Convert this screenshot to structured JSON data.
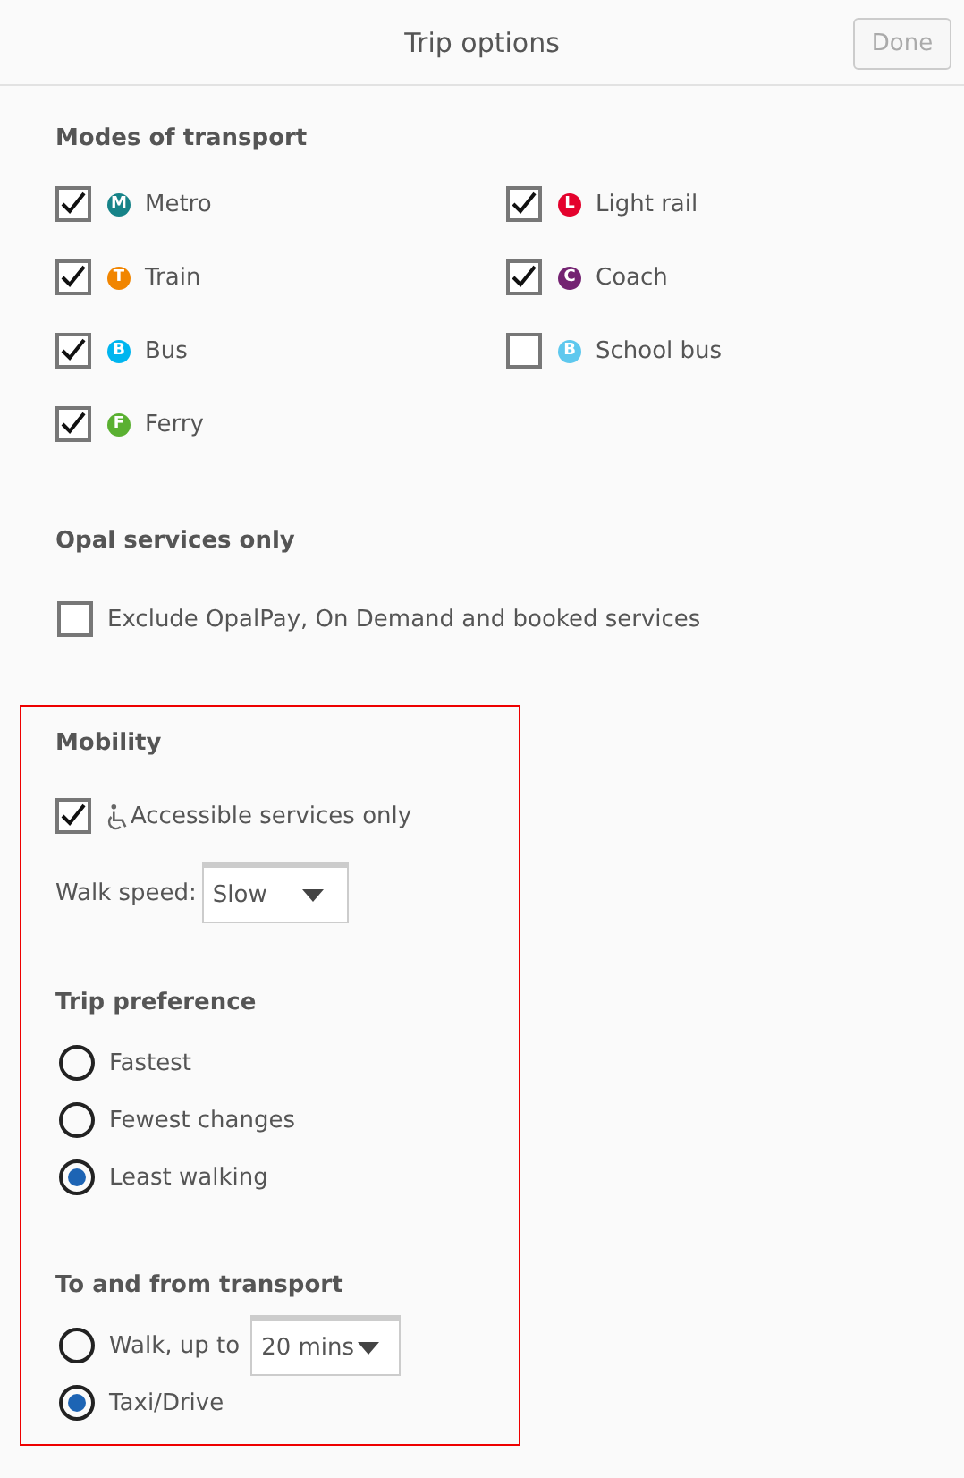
{
  "header": {
    "title": "Trip options",
    "done_button": {
      "label": "Done",
      "disabled": true
    }
  },
  "modes": {
    "heading": "Modes of transport",
    "items": [
      {
        "label": "Metro",
        "badge": "M",
        "color": "#168388",
        "checked": true
      },
      {
        "label": "Light rail",
        "badge": "L",
        "color": "#e4022d",
        "checked": true
      },
      {
        "label": "Train",
        "badge": "T",
        "color": "#f18500",
        "checked": true
      },
      {
        "label": "Coach",
        "badge": "C",
        "color": "#742372",
        "checked": true
      },
      {
        "label": "Bus",
        "badge": "B",
        "color": "#00b5ef",
        "checked": true
      },
      {
        "label": "School bus",
        "badge": "B",
        "color": "#5ec8ee",
        "checked": false
      },
      {
        "label": "Ferry",
        "badge": "F",
        "color": "#5ab031",
        "checked": true
      }
    ]
  },
  "opal": {
    "heading": "Opal services only",
    "option": {
      "label": "Exclude OpalPay, On Demand and booked services",
      "checked": false
    }
  },
  "mobility": {
    "heading": "Mobility",
    "accessible": {
      "label": "Accessible services only",
      "checked": true
    },
    "walk_speed": {
      "label": "Walk speed:",
      "value": "Slow"
    }
  },
  "trip_preference": {
    "heading": "Trip preference",
    "options": [
      {
        "label": "Fastest",
        "selected": false
      },
      {
        "label": "Fewest changes",
        "selected": false
      },
      {
        "label": "Least walking",
        "selected": true
      }
    ]
  },
  "to_and_from": {
    "heading": "To and from transport",
    "options": [
      {
        "kind": "dropdown",
        "label": "Walk, up to",
        "value": "20 mins",
        "selected": false
      },
      {
        "kind": "plain",
        "label": "Taxi/Drive",
        "selected": true
      }
    ]
  }
}
